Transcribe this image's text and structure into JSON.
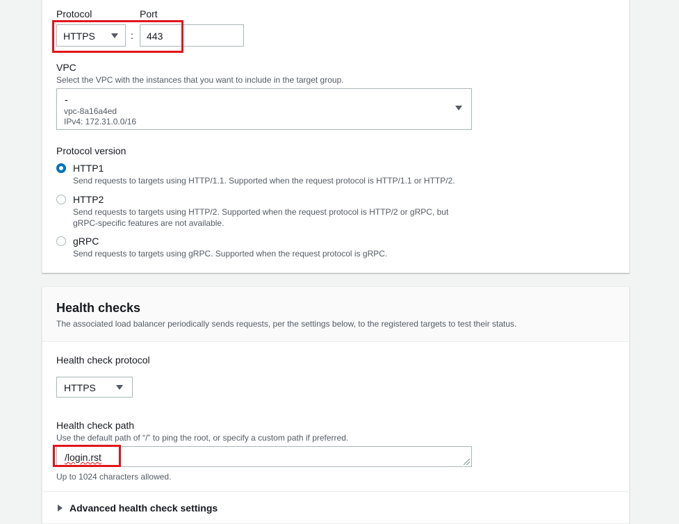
{
  "target_group": {
    "protocol_label": "Protocol",
    "port_label": "Port",
    "protocol_value": "HTTPS",
    "separator": ":",
    "port_value": "443",
    "vpc_label": "VPC",
    "vpc_description": "Select the VPC with the instances that you want to include in the target group.",
    "vpc_selected": {
      "name": "-",
      "id": "vpc-8a16a4ed",
      "cidr": "IPv4: 172.31.0.0/16"
    },
    "protocol_version_label": "Protocol version",
    "protocol_versions": [
      {
        "label": "HTTP1",
        "description": "Send requests to targets using HTTP/1.1. Supported when the request protocol is HTTP/1.1 or HTTP/2.",
        "checked": true
      },
      {
        "label": "HTTP2",
        "description": "Send requests to targets using HTTP/2. Supported when the request protocol is HTTP/2 or gRPC, but",
        "description_line2": "gRPC-specific features are not available.",
        "checked": false
      },
      {
        "label": "gRPC",
        "description": "Send requests to targets using gRPC. Supported when the request protocol is gRPC.",
        "checked": false
      }
    ]
  },
  "health_checks": {
    "title": "Health checks",
    "description": "The associated load balancer periodically sends requests, per the settings below, to the registered targets to test their status.",
    "protocol_label": "Health check protocol",
    "protocol_value": "HTTPS",
    "path_label": "Health check path",
    "path_description": "Use the default path of “/” to ping the root, or specify a custom path if preferred.",
    "path_value": "/login.rst",
    "path_constraint": "Up to 1024 characters allowed.",
    "advanced_label": "Advanced health check settings"
  },
  "colors": {
    "highlight": "#e0151b",
    "radio_checked": "#0073bb",
    "page_bg": "#f2f3f3"
  },
  "icons": [
    "caret-down-icon",
    "caret-right-icon",
    "resize-grip-icon"
  ]
}
